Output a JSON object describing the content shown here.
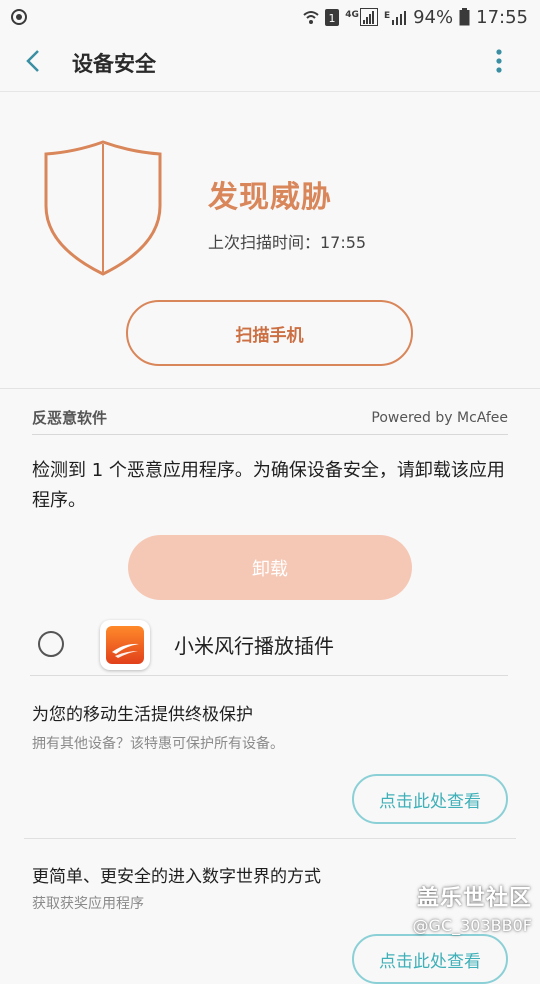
{
  "status_bar": {
    "network_label_1": "4G",
    "network_label_2": "E",
    "battery": "94%",
    "time": "17:55",
    "icons": [
      "sync-icon",
      "wifi-icon",
      "sim-icon",
      "signal-icon",
      "battery-icon"
    ]
  },
  "app_bar": {
    "title": "设备安全",
    "back_icon": "back-chevron-icon",
    "more_icon": "more-vert-icon"
  },
  "threat": {
    "title": "发现威胁",
    "last_scan": "上次扫描时间：17:55",
    "icon": "shield-icon"
  },
  "scan_button": "扫描手机",
  "malware_section": {
    "title": "反恶意软件",
    "powered_by": "Powered by McAfee",
    "description": "检测到 1 个恶意应用程序。为确保设备安全，请卸载该应用程序。",
    "uninstall_label": "卸载",
    "app": {
      "name": "小米风行播放插件",
      "selected": false
    }
  },
  "promo1": {
    "title": "为您的移动生活提供终极保护",
    "subtitle": "拥有其他设备？该特惠可保护所有设备。",
    "button": "点击此处查看"
  },
  "promo2": {
    "title": "更简单、更安全的进入数字世界的方式",
    "subtitle": "获取获奖应用程序",
    "button": "点击此处查看"
  },
  "watermark": {
    "title": "盖乐世社区",
    "user": "@GC_303BB0F"
  },
  "colors": {
    "accent_orange": "#d9865a",
    "uninstall_fill": "#f5c8b6",
    "teal": "#3fb0b8",
    "back_icon": "#3a8fa3"
  }
}
